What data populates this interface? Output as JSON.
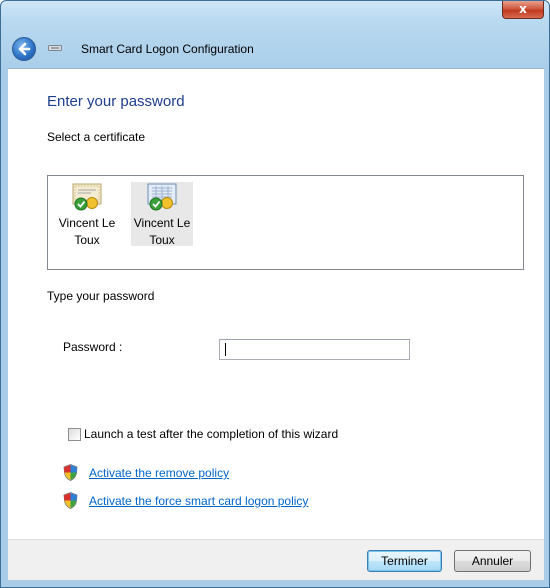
{
  "window": {
    "title": "Smart Card Logon Configuration",
    "close_label": "x"
  },
  "page": {
    "heading": "Enter your password",
    "select_certificate_label": "Select a certificate",
    "certificates": [
      {
        "name_line1": "Vincent Le",
        "name_line2": "Toux",
        "selected": false,
        "icon": "certificate-icon"
      },
      {
        "name_line1": "Vincent Le",
        "name_line2": "Toux",
        "selected": true,
        "icon": "certificate-icon"
      }
    ],
    "type_password_label": "Type your password",
    "password_label": "Password :",
    "password_value": "",
    "test_checkbox_label": "Launch a test after the completion of this wizard",
    "test_checkbox_checked": false,
    "links": [
      {
        "label": "Activate the remove policy",
        "icon": "uac-shield-icon"
      },
      {
        "label": "Activate the force smart card logon policy",
        "icon": "uac-shield-icon"
      }
    ]
  },
  "footer": {
    "finish_label": "Terminer",
    "cancel_label": "Annuler"
  },
  "colors": {
    "heading": "#1e3d8f",
    "link": "#0066cc",
    "close_button": "#c0391f"
  }
}
